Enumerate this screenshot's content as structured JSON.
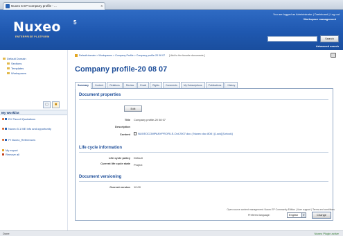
{
  "browser": {
    "tab_title": "Nuxeo 5 EP Company profile - ...",
    "tab_close": "x"
  },
  "header": {
    "logo_name": "Nuxeo",
    "logo_sup": "5",
    "logo_tagline": "ENTERPRISE PLATFORM",
    "logged_in": "You are logged as Administrator | Dashboard | Log out",
    "workspace_mgmt": "Workspace management",
    "search_value": "",
    "search_button": "Search",
    "advanced_search": "Advanced search"
  },
  "sidebar": {
    "tree": [
      "Default Domain",
      "Sections",
      "Templates",
      "Workspaces"
    ],
    "tab_icons": [
      "clipboard-icon",
      "folder-icon"
    ],
    "worklist_title": "My Worklist",
    "worklist_items": [
      "EV Parcell Quotations",
      "Nuxeo 5.1 ME Info and opportunity",
      "PI Nuxeo_References"
    ],
    "actions": [
      "My export",
      "Remove all"
    ]
  },
  "main": {
    "breadcrumb": "Default domain > Workspaces > Company Profile > Company profile-20 08 07",
    "add_favorite": "[ Add to the favorite documents ]",
    "title": "Company profile-20 08 07",
    "tabs": [
      "Summary",
      "Content",
      "Relations",
      "Review",
      "Email",
      "Rights",
      "Comments",
      "My Subscriptions",
      "Publications",
      "History"
    ],
    "active_tab": "Summary",
    "doc_props_title": "Document properties",
    "edit_button": "Edit",
    "properties": [
      {
        "label": "Title",
        "value": "Company profile-20 08 07"
      },
      {
        "label": "Description",
        "value": ""
      },
      {
        "label": "Content",
        "value": "NUXEOCOMPANYPROFILE-Oct 2007.doc ( Nuxeo doc 808 ) [Lock] [Unlock]"
      }
    ],
    "lifecycle_title": "Life cycle information",
    "lifecycle": [
      {
        "label": "Life cycle policy",
        "value": "Default"
      },
      {
        "label": "Current life cycle state",
        "value": "Project"
      }
    ],
    "versioning_title": "Document versioning",
    "versioning": [
      {
        "label": "Current version",
        "value": "10.00"
      }
    ]
  },
  "footer": {
    "credits": "Open source content management: Nuxeo EP Community Edition | User support | Terms and conditions",
    "lang_label": "Preferred language:",
    "lang_value": "English",
    "change_button": "Change"
  },
  "status": {
    "left": "Done",
    "right": "Nuxeo Plugin active"
  }
}
